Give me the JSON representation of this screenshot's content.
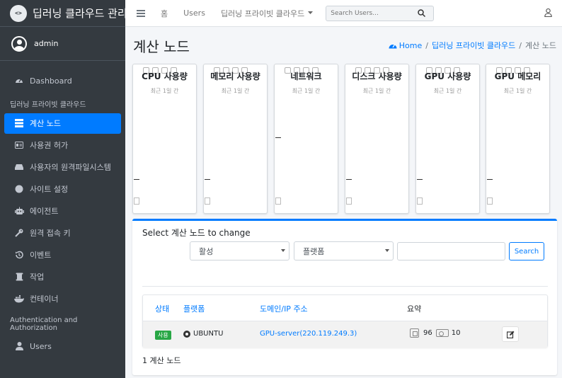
{
  "brand": {
    "title": "딥러닝 클라우드 관리",
    "logo_text": "<>"
  },
  "user": {
    "name": "admin"
  },
  "sidebar": {
    "items": [
      {
        "label": "Dashboard",
        "icon": "tachometer-icon"
      },
      {
        "header": "딥러닝 프라이빗 클라우드"
      },
      {
        "label": "계산 노드",
        "icon": "server-icon",
        "active": true
      },
      {
        "label": "사용권 허가",
        "icon": "id-card-icon"
      },
      {
        "label": "사용자의 원격파일시스템",
        "icon": "hdd-icon"
      },
      {
        "label": "사이트 설정",
        "icon": "circle-icon"
      },
      {
        "label": "에이전트",
        "icon": "robot-icon"
      },
      {
        "label": "원격 접속 키",
        "icon": "key-icon"
      },
      {
        "label": "이벤트",
        "icon": "history-icon"
      },
      {
        "label": "작업",
        "icon": "scroll-icon"
      },
      {
        "label": "컨테이너",
        "icon": "docker-icon"
      },
      {
        "header": "Authentication and Authorization"
      },
      {
        "label": "Users",
        "icon": "user-icon"
      }
    ]
  },
  "topbar": {
    "home": "홈",
    "users": "Users",
    "cloud_dropdown": "딥러닝 프라이빗 클라우드",
    "search_placeholder": "Search Users..."
  },
  "header": {
    "title": "계산 노드",
    "breadcrumb_home": "Home",
    "breadcrumb_cloud": "딥러닝 프라이빗 클라우드",
    "breadcrumb_current": "계산 노드"
  },
  "cards": [
    {
      "title": "CPU 사용량",
      "subtitle": "최근 1일 간"
    },
    {
      "title": "메모리 사용량",
      "subtitle": "최근 1일 간"
    },
    {
      "title": "네트워크",
      "subtitle": "최근 1일 간"
    },
    {
      "title": "디스크 사용량",
      "subtitle": "최근 1일 간"
    },
    {
      "title": "GPU 사용량",
      "subtitle": "최근 1일 간"
    },
    {
      "title": "GPU 메모리",
      "subtitle": "최근 1일 간"
    }
  ],
  "changelist": {
    "title": "Select 계산 노드 to change",
    "filter_active": "활성",
    "filter_platform": "플랫폼",
    "search_button": "Search",
    "columns": {
      "status": "상태",
      "platform": "플랫폼",
      "domain": "도메인/IP 주소",
      "summary": "요약"
    },
    "rows": [
      {
        "status": "사용",
        "platform": "UBUNTU",
        "domain": "GPU-server(220.119.249.3)",
        "cpu": "96",
        "gpu": "10"
      }
    ],
    "count": "1 계산 노드"
  },
  "colors": {
    "accent": "#007bff",
    "sidebar": "#343a40",
    "success": "#28a745"
  }
}
